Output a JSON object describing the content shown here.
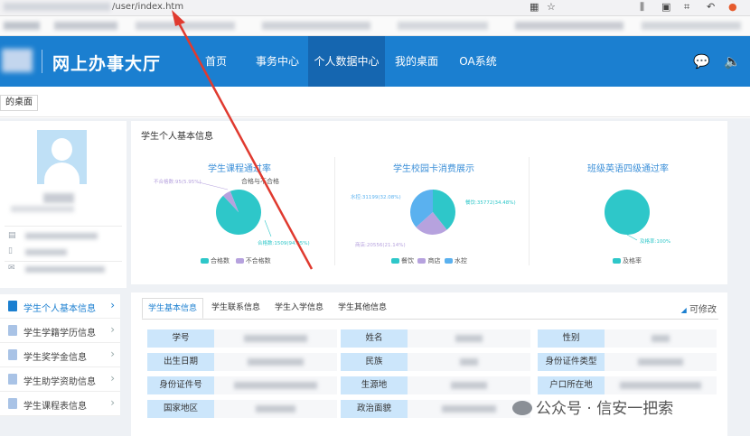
{
  "browser": {
    "url_tail": "/user/index.htm",
    "icons": [
      "qr-code-icon",
      "star-icon",
      "library-icon",
      "sidebar-icon",
      "crop-icon",
      "undo-icon",
      "extension-icon"
    ]
  },
  "header": {
    "site_title": "网上办事大厅",
    "nav": [
      "首页",
      "事务中心",
      "个人数据中心",
      "我的桌面",
      "OA系统"
    ],
    "active_nav": "个人数据中心",
    "right_icons": [
      "chat-icon",
      "speaker-icon"
    ],
    "brand_color": "#1b7fd0"
  },
  "tabs": {
    "current": "的桌面"
  },
  "sidebar_menu": [
    {
      "label": "学生个人基本信息",
      "active": true
    },
    {
      "label": "学生学籍学历信息",
      "active": false
    },
    {
      "label": "学生奖学金信息",
      "active": false
    },
    {
      "label": "学生助学资助信息",
      "active": false
    },
    {
      "label": "学生课程表信息",
      "active": false
    }
  ],
  "info_panel": {
    "title": "学生个人基本信息",
    "charts": [
      {
        "title": "学生课程通过率",
        "type": "pie",
        "subtitle": "合格与不合格",
        "slices": [
          {
            "name": "合格数",
            "label": "合格数:1509(94.05%)",
            "value": 94.05,
            "color": "#2ec7c9"
          },
          {
            "name": "不合格数",
            "label": "不合格数:95(5.95%)",
            "value": 5.95,
            "color": "#b6a2de"
          }
        ]
      },
      {
        "title": "学生校园卡消费展示",
        "type": "pie",
        "slices": [
          {
            "name": "餐饮",
            "label": "餐饮:35772(34.48%)",
            "value": 34.48,
            "color": "#2ec7c9"
          },
          {
            "name": "商店",
            "label": "商店:20556(21.14%)",
            "value": 21.14,
            "color": "#b6a2de"
          },
          {
            "name": "水控",
            "label": "水控:31199(32.08%)",
            "value": 32.08,
            "color": "#5ab1ef"
          }
        ]
      },
      {
        "title": "班级英语四级通过率",
        "type": "pie",
        "slices": [
          {
            "name": "及格率",
            "label": "及格率:100%",
            "value": 100,
            "color": "#2ec7c9"
          }
        ]
      }
    ]
  },
  "detail_panel": {
    "tabs": [
      "学生基本信息",
      "学生联系信息",
      "学生入学信息",
      "学生其他信息"
    ],
    "active_tab": "学生基本信息",
    "edit_label": "可修改",
    "rows": [
      [
        "学号",
        "姓名",
        "性别"
      ],
      [
        "出生日期",
        "民族",
        "身份证件类型"
      ],
      [
        "身份证件号",
        "生源地",
        "户口所在地"
      ],
      [
        "国家地区",
        "政治面貌",
        ""
      ]
    ]
  },
  "watermark": "公众号 · 信安一把索"
}
